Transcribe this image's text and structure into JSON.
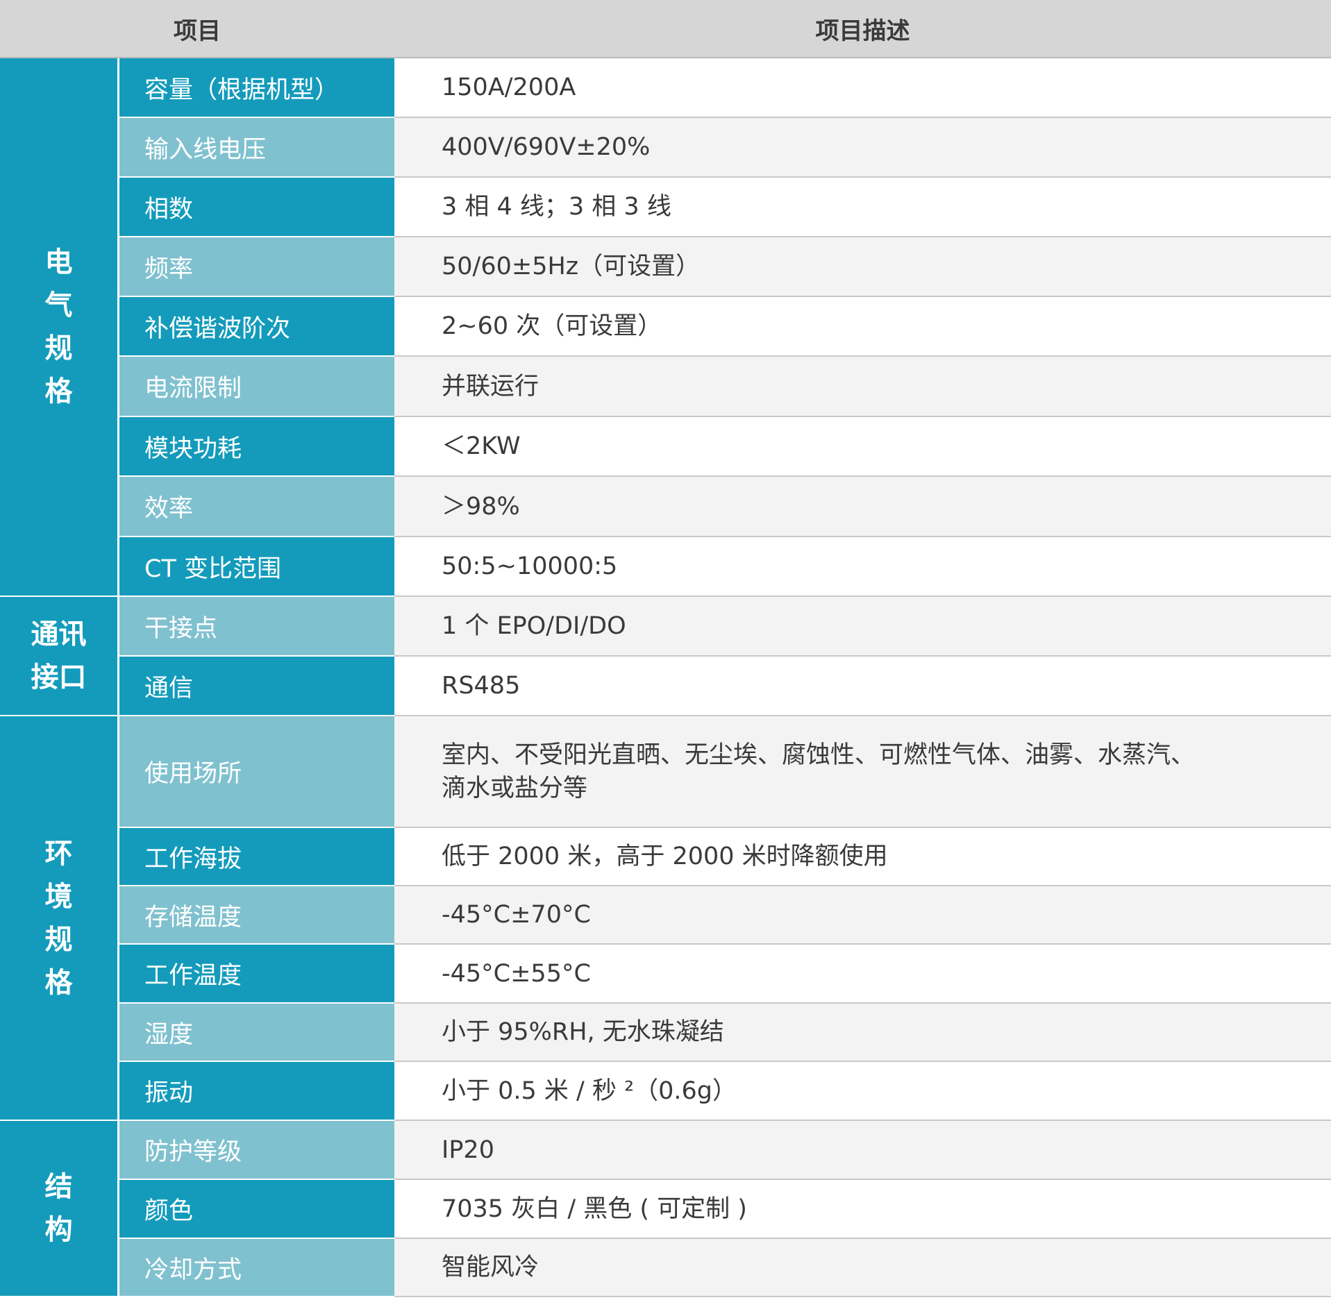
{
  "header": {
    "item": "项目",
    "description": "项目描述"
  },
  "colors": {
    "dark_teal": "#149bbb",
    "light_teal": "#80c1cf",
    "header_gray": "#d6d6d7",
    "row_gray": "#f4f3f3"
  },
  "categories": [
    {
      "label": "电气规格",
      "rows": 9
    },
    {
      "label": "通讯接口",
      "rows": 2
    },
    {
      "label": "环境规格",
      "rows": 6
    },
    {
      "label": "结构",
      "rows": 3
    }
  ],
  "rows": [
    {
      "item": "容量（根据机型）",
      "desc": "150A/200A"
    },
    {
      "item": "输入线电压",
      "desc": "400V/690V±20%"
    },
    {
      "item": "相数",
      "desc": "3 相 4 线；3 相 3 线"
    },
    {
      "item": "频率",
      "desc": "50/60±5Hz（可设置）"
    },
    {
      "item": "补偿谐波阶次",
      "desc": "2~60 次（可设置）"
    },
    {
      "item": "电流限制",
      "desc": "并联运行"
    },
    {
      "item": "模块功耗",
      "desc": "＜2KW"
    },
    {
      "item": "效率",
      "desc": "＞98%"
    },
    {
      "item": "CT 变比范围",
      "desc": "50:5~10000:5"
    },
    {
      "item": "干接点",
      "desc": "1 个 EPO/DI/DO"
    },
    {
      "item": "通信",
      "desc": "RS485"
    },
    {
      "item": "使用场所",
      "desc": "室内、不受阳光直晒、无尘埃、腐蚀性、可燃性气体、油雾、水蒸汽、滴水或盐分等"
    },
    {
      "item": "工作海拔",
      "desc": "低于 2000 米，高于 2000 米时降额使用"
    },
    {
      "item": "存储温度",
      "desc": "-45°C±70°C"
    },
    {
      "item": "工作温度",
      "desc": "-45°C±55°C"
    },
    {
      "item": "湿度",
      "desc": "小于 95%RH, 无水珠凝结"
    },
    {
      "item": "振动",
      "desc": "小于 0.5 米 / 秒 ²（0.6g）"
    },
    {
      "item": "防护等级",
      "desc": "IP20"
    },
    {
      "item": "颜色",
      "desc": "7035 灰白 / 黑色 ( 可定制 )"
    },
    {
      "item": "冷却方式",
      "desc": "智能风冷"
    }
  ]
}
